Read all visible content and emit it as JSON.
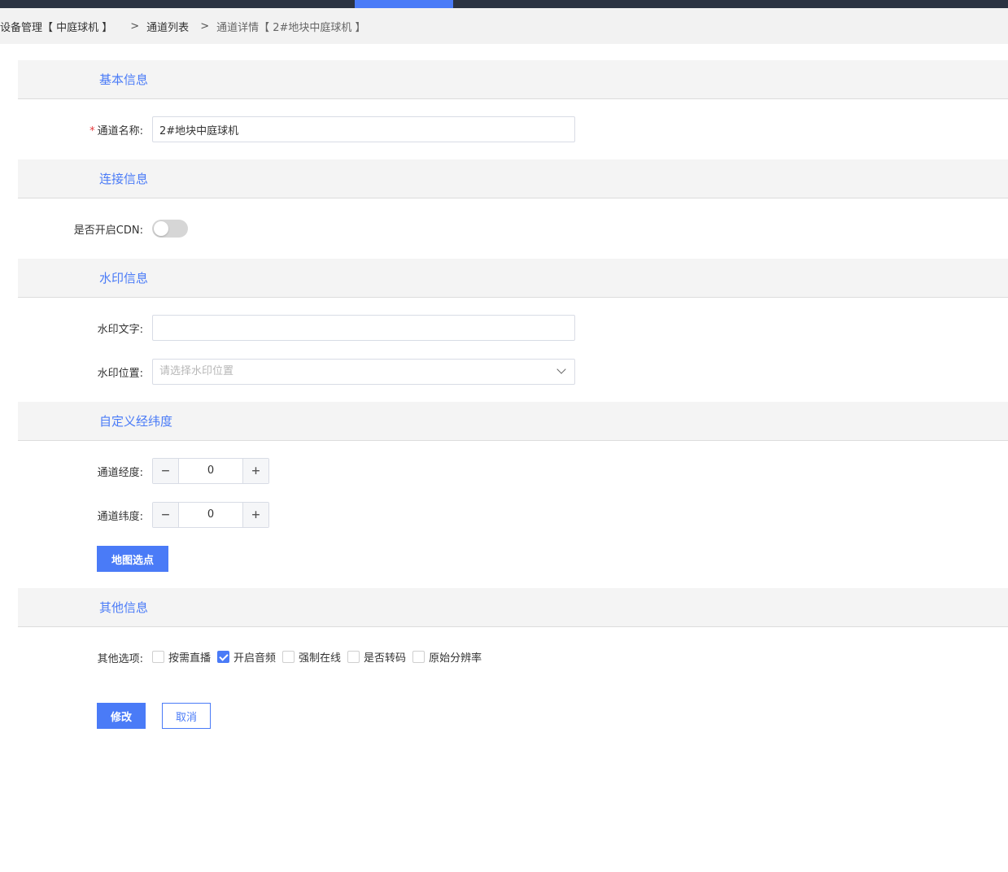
{
  "breadcrumb": {
    "item1": "设备管理【 中庭球机 】",
    "sep": ">",
    "item2": "通道列表",
    "item3": "通道详情【 2#地块中庭球机 】"
  },
  "sections": {
    "basic": "基本信息",
    "connection": "连接信息",
    "watermark": "水印信息",
    "coords": "自定义经纬度",
    "other": "其他信息"
  },
  "form": {
    "channel_name_label": "通道名称:",
    "channel_name_required": "*",
    "channel_name_value": "2#地块中庭球机",
    "cdn_label": "是否开启CDN:",
    "cdn_enabled": false,
    "watermark_text_label": "水印文字:",
    "watermark_text_value": "",
    "watermark_pos_label": "水印位置:",
    "watermark_pos_placeholder": "请选择水印位置",
    "longitude_label": "通道经度:",
    "longitude_value": "0",
    "latitude_label": "通道纬度:",
    "latitude_value": "0",
    "stepper_minus": "−",
    "stepper_plus": "+",
    "map_pick_button": "地图选点",
    "other_options_label": "其他选项:",
    "options": [
      {
        "label": "按需直播",
        "checked": false
      },
      {
        "label": "开启音频",
        "checked": true
      },
      {
        "label": "强制在线",
        "checked": false
      },
      {
        "label": "是否转码",
        "checked": false
      },
      {
        "label": "原始分辨率",
        "checked": false
      }
    ]
  },
  "actions": {
    "submit": "修改",
    "cancel": "取消"
  },
  "colors": {
    "accent": "#4a7bf7",
    "topbar": "#2b3342",
    "required": "#e4393c"
  }
}
